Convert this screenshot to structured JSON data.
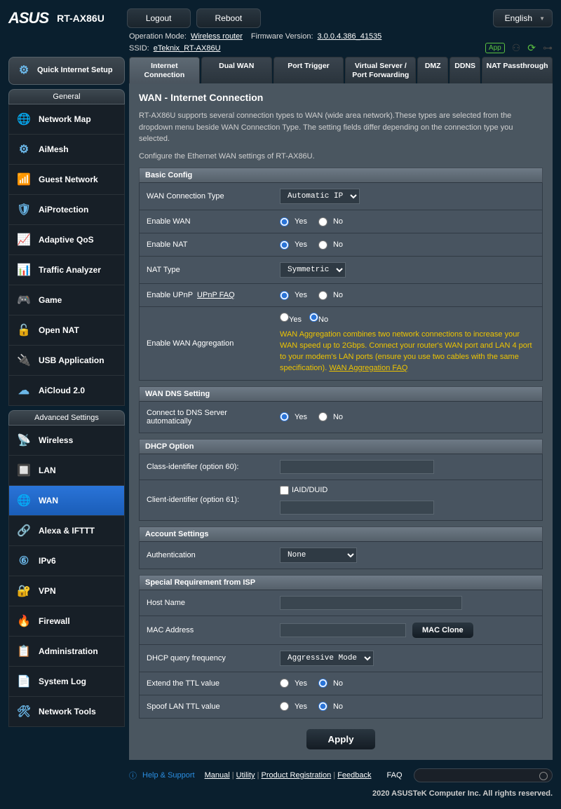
{
  "header": {
    "brand": "ASUS",
    "model": "RT-AX86U",
    "logout": "Logout",
    "reboot": "Reboot",
    "language": "English",
    "op_mode_lbl": "Operation Mode:",
    "op_mode": "Wireless router",
    "fw_lbl": "Firmware Version:",
    "fw": "3.0.0.4.386_41535",
    "ssid_lbl": "SSID:",
    "ssid": "eTeknix_RT-AX86U",
    "app": "App"
  },
  "sidebar": {
    "qis": "Quick Internet Setup",
    "general_hdr": "General",
    "general": [
      "Network Map",
      "AiMesh",
      "Guest Network",
      "AiProtection",
      "Adaptive QoS",
      "Traffic Analyzer",
      "Game",
      "Open NAT",
      "USB Application",
      "AiCloud 2.0"
    ],
    "adv_hdr": "Advanced Settings",
    "adv": [
      "Wireless",
      "LAN",
      "WAN",
      "Alexa & IFTTT",
      "IPv6",
      "VPN",
      "Firewall",
      "Administration",
      "System Log",
      "Network Tools"
    ],
    "active": "WAN"
  },
  "tabs": {
    "items": [
      "Internet Connection",
      "Dual WAN",
      "Port Trigger",
      "Virtual Server / Port Forwarding",
      "DMZ",
      "DDNS",
      "NAT Passthrough"
    ],
    "active": "Internet Connection"
  },
  "content": {
    "title": "WAN - Internet Connection",
    "desc1": "RT-AX86U supports several connection types to WAN (wide area network).These types are selected from the dropdown menu beside WAN Connection Type. The setting fields differ depending on the connection type you selected.",
    "desc2": "Configure the Ethernet WAN settings of RT-AX86U.",
    "basic_hdr": "Basic Config",
    "wan_type_lbl": "WAN Connection Type",
    "wan_type": "Automatic IP",
    "enable_wan_lbl": "Enable WAN",
    "enable_nat_lbl": "Enable NAT",
    "nat_type_lbl": "NAT Type",
    "nat_type": "Symmetric",
    "upnp_lbl": "Enable UPnP",
    "upnp_faq": "UPnP  FAQ",
    "wan_agg_lbl": "Enable WAN Aggregation",
    "wan_agg_text": "WAN Aggregation combines two network connections to increase your WAN speed up to 2Gbps. Connect your router's WAN port and LAN 4 port to your modem's LAN ports (ensure you use two cables with the same specification).",
    "wan_agg_faq": "WAN Aggregation FAQ",
    "dns_hdr": "WAN DNS Setting",
    "dns_auto_lbl": "Connect to DNS Server automatically",
    "dhcp_hdr": "DHCP Option",
    "opt60_lbl": "Class-identifier (option 60):",
    "opt61_lbl": "Client-identifier (option 61):",
    "opt61_cb": "IAID/DUID",
    "acct_hdr": "Account Settings",
    "auth_lbl": "Authentication",
    "auth": "None",
    "isp_hdr": "Special Requirement from ISP",
    "host_lbl": "Host Name",
    "mac_lbl": "MAC Address",
    "mac_clone": "MAC Clone",
    "dhcp_freq_lbl": "DHCP query frequency",
    "dhcp_freq": "Aggressive Mode",
    "ttl_lbl": "Extend the TTL value",
    "spoof_lbl": "Spoof LAN TTL value",
    "yes": "Yes",
    "no": "No",
    "apply": "Apply"
  },
  "footer": {
    "hs": "Help & Support",
    "links": [
      "Manual",
      "Utility",
      "Product Registration",
      "Feedback"
    ],
    "faq": "FAQ",
    "copy": "2020 ASUSTeK Computer Inc. All rights reserved."
  }
}
